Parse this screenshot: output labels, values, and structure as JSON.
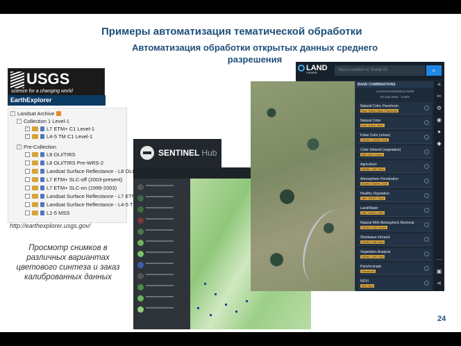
{
  "slide": {
    "title": "Примеры автоматизация тематической обработки",
    "subtitle": "Автоматизация обработки открытых данных среднего разрешения",
    "page_number": "24"
  },
  "usgs": {
    "logo_text": "USGS",
    "tagline": "science for a changing world",
    "app_name": "EarthExplorer"
  },
  "tree": {
    "root": "Landsat Archive",
    "collection": "Collection 1 Level-1",
    "collection_items": [
      "L7 ETM+ C1 Level-1",
      "L4-5 TM C1 Level-1"
    ],
    "pre": "Pre-Collection",
    "pre_items": [
      "L8 OLI/TIRS",
      "L8 OLI/TIRS Pre-WRS-2",
      "Landsat Surface Reflectance - L8 OLI/TIRS",
      "L7 ETM+ SLC-off (2003-present)",
      "L7 ETM+ SLC-on (1999-2003)",
      "Landsat Surface Reflectance - L7 ETM+",
      "Landsat Surface Reflectance - L4-5 TM",
      "L1-5 MSS"
    ]
  },
  "url": "http://earthexplorer.usgs.gov/",
  "note": "Просмотр снимков в различных вариантах цветового синтеза и заказ калиброванных данных",
  "landviewer": {
    "logo": "LAND",
    "logo_sub": "VIEWER",
    "search_placeholder": "Input Location or Scene ID",
    "panel_title": "BAND COMBINATIONS",
    "scene_id": "LC81610122016261LGN00",
    "scene_date": "02 Sep 2016",
    "cloud": "3.53%",
    "bands": [
      {
        "name": "Natural Color, Panchrom",
        "tag": "Red, Green, Blue, Panchrom"
      },
      {
        "name": "Natural Color",
        "tag": "Red, Green, Blue"
      },
      {
        "name": "False Color (urban)",
        "tag": "SWIR2, SWIR1, Red"
      },
      {
        "name": "Color Infrared (vegetation)",
        "tag": "NIR, Red, Green"
      },
      {
        "name": "Agriculture",
        "tag": "SWIR1, NIR, Blue"
      },
      {
        "name": "Atmospheric Penetration",
        "tag": "SWIR2, SWIR1, NIR"
      },
      {
        "name": "Healthy Vegetation",
        "tag": "NIR, SWIR1, Blue"
      },
      {
        "name": "Land/Water",
        "tag": "NIR, SWIR1, Red"
      },
      {
        "name": "Natural With Atmospheric Removal",
        "tag": "SWIR2, NIR, Green"
      },
      {
        "name": "Shortwave Infrared",
        "tag": "SWIR2, NIR, Red"
      },
      {
        "name": "Vegetation Analysis",
        "tag": "SWIR1, NIR, Red"
      },
      {
        "name": "Panchromatic",
        "tag": "Panchrom"
      },
      {
        "name": "NDVI",
        "tag": "NIR, Red"
      }
    ]
  },
  "sentinel": {
    "logo": "SENTINEL",
    "logo_sub": "Hub"
  }
}
